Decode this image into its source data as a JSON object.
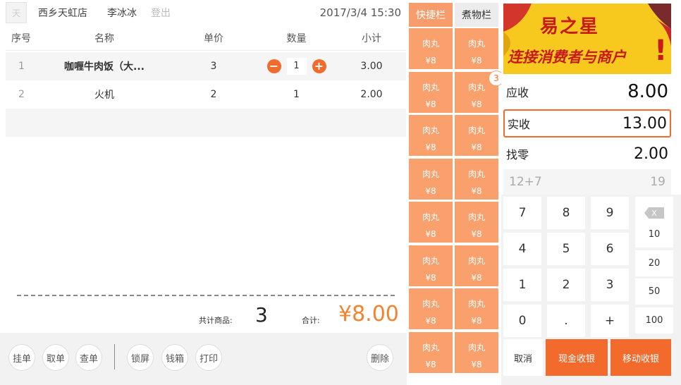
{
  "header": {
    "logo_text": "天",
    "store": "西乡天虹店",
    "user": "李冰冰",
    "logout": "登出",
    "datetime": "2017/3/4  15:30"
  },
  "table": {
    "columns": [
      "序号",
      "名称",
      "单价",
      "数量",
      "小计"
    ],
    "rows": [
      {
        "index": "1",
        "name": "咖喱牛肉饭（大...",
        "price": "3",
        "qty": "1",
        "subtotal": "3.00"
      },
      {
        "index": "2",
        "name": "火机",
        "price": "2",
        "qty": "1",
        "subtotal": "2.00"
      }
    ]
  },
  "summary": {
    "count_label": "共计商品:",
    "count": "3",
    "total_label": "合计:",
    "total": "¥8.00"
  },
  "actions": {
    "hang": "挂单",
    "take": "取单",
    "check": "查单",
    "lock": "锁屏",
    "cashbox": "钱箱",
    "print": "打印",
    "delete": "删除"
  },
  "tabs": [
    "快捷栏",
    "煮物栏"
  ],
  "products": [
    {
      "name": "肉丸",
      "price": "¥8"
    },
    {
      "name": "肉丸",
      "price": "¥8"
    },
    {
      "name": "肉丸",
      "price": "¥8"
    },
    {
      "name": "肉丸",
      "price": "¥8",
      "badge": "3"
    },
    {
      "name": "肉丸",
      "price": "¥8"
    },
    {
      "name": "肉丸",
      "price": "¥8"
    },
    {
      "name": "肉丸",
      "price": "¥8"
    },
    {
      "name": "肉丸",
      "price": "¥8"
    },
    {
      "name": "肉丸",
      "price": "¥8"
    },
    {
      "name": "肉丸",
      "price": "¥8"
    },
    {
      "name": "肉丸",
      "price": "¥8"
    },
    {
      "name": "肉丸",
      "price": "¥8"
    },
    {
      "name": "肉丸",
      "price": "¥8"
    },
    {
      "name": "肉丸",
      "price": "¥8"
    },
    {
      "name": "肉丸",
      "price": "¥8"
    },
    {
      "name": "肉丸",
      "price": "¥8"
    }
  ],
  "banner": {
    "title": "易之星",
    "subtitle": "连接消费者与商户",
    "exclaim": "!"
  },
  "payment": {
    "due_label": "应收",
    "due": "8.00",
    "received_label": "实收",
    "received": "13.00",
    "change_label": "找零",
    "change": "2.00",
    "expression": "12+7",
    "expression_result": "19"
  },
  "keypad": {
    "keys": [
      "7",
      "8",
      "9",
      "4",
      "5",
      "6",
      "1",
      "2",
      "3",
      "0",
      ".",
      "+"
    ],
    "quick": [
      "10",
      "20",
      "50",
      "100"
    ],
    "backspace": "X",
    "cancel": "取消",
    "cash_pay": "现金收银",
    "mobile_pay": "移动收银"
  }
}
